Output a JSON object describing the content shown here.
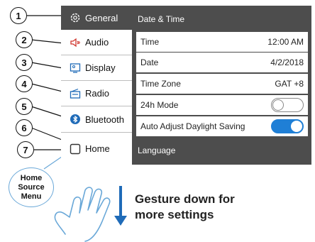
{
  "sidebar": {
    "items": [
      {
        "label": "General",
        "icon": "gear-icon"
      },
      {
        "label": "Audio",
        "icon": "speaker-icon"
      },
      {
        "label": "Display",
        "icon": "display-icon"
      },
      {
        "label": "Radio",
        "icon": "radio-icon"
      },
      {
        "label": "Bluetooth",
        "icon": "bluetooth-icon"
      },
      {
        "label": "Home",
        "icon": "home-square-icon"
      }
    ]
  },
  "content": {
    "section_title": "Date & Time",
    "rows": [
      {
        "label": "Time",
        "value": "12:00 AM"
      },
      {
        "label": "Date",
        "value": "4/2/2018"
      },
      {
        "label": "Time Zone",
        "value": "GAT +8"
      },
      {
        "label": "24h Mode",
        "toggle": "off"
      },
      {
        "label": "Auto Adjust Daylight Saving",
        "toggle": "on"
      }
    ],
    "next_section": "Language"
  },
  "callouts": [
    "1",
    "2",
    "3",
    "4",
    "5",
    "6",
    "7"
  ],
  "home_callout": {
    "line1": "Home",
    "line2": "Source",
    "line3": "Menu"
  },
  "gesture": {
    "line1": "Gesture down for",
    "line2": "more settings"
  },
  "colors": {
    "screen_bg": "#4d4d4d",
    "toggle_on": "#1f7fd6",
    "callout_bubble": "#6aa8d8"
  }
}
